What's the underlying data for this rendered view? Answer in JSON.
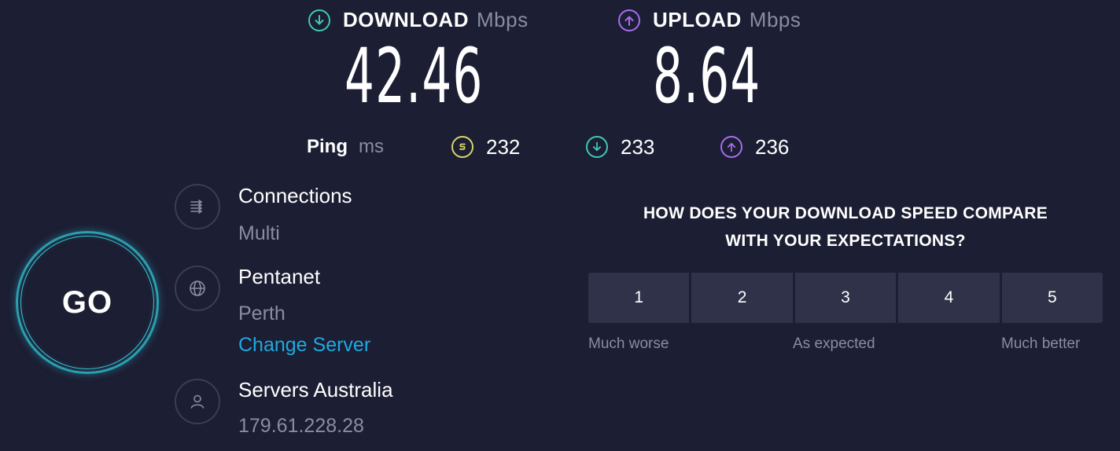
{
  "colors": {
    "background": "#1c1e33",
    "download_accent": "#3ec9b5",
    "upload_accent": "#a86cf0",
    "ping_idle_accent": "#d8d46a",
    "link": "#1ea9e0",
    "go_ring": "#2a9fb0"
  },
  "download": {
    "label": "DOWNLOAD",
    "unit": "Mbps",
    "value": "42.46",
    "icon": "arrow-down-circle-icon"
  },
  "upload": {
    "label": "UPLOAD",
    "unit": "Mbps",
    "value": "8.64",
    "icon": "arrow-up-circle-icon"
  },
  "ping": {
    "label": "Ping",
    "unit": "ms",
    "idle": "232",
    "download": "233",
    "upload": "236"
  },
  "go_button": {
    "label": "GO"
  },
  "connections": {
    "title": "Connections",
    "value": "Multi",
    "icon": "connections-icon"
  },
  "isp": {
    "title": "Pentanet",
    "location": "Perth",
    "change_server": "Change Server",
    "icon": "globe-icon"
  },
  "server": {
    "title": "Servers Australia",
    "ip": "179.61.228.28",
    "icon": "user-icon"
  },
  "survey": {
    "question_line1": "HOW DOES YOUR DOWNLOAD SPEED COMPARE",
    "question_line2": "WITH YOUR EXPECTATIONS?",
    "options": [
      "1",
      "2",
      "3",
      "4",
      "5"
    ],
    "low_label": "Much worse",
    "mid_label": "As expected",
    "high_label": "Much better"
  }
}
